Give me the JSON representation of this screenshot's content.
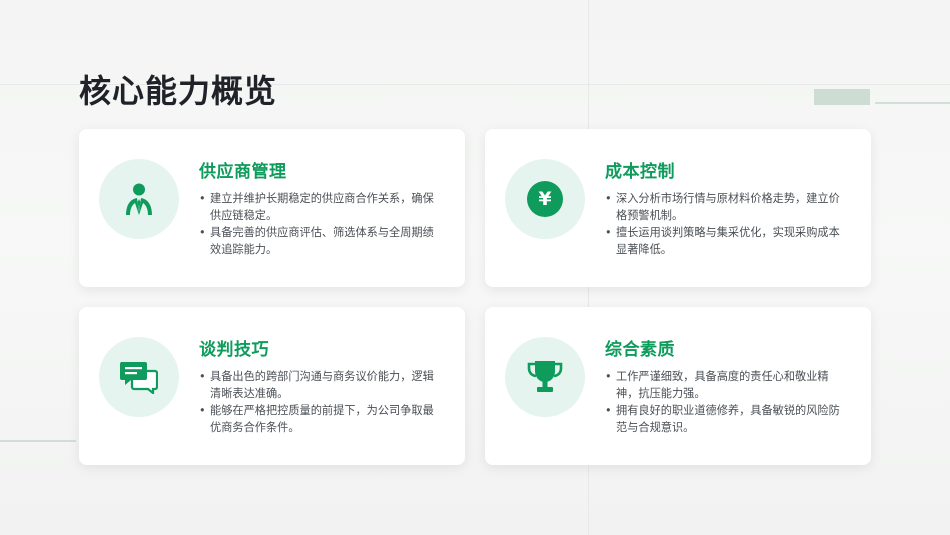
{
  "page": {
    "title": "核心能力概览",
    "accent_color": "#0e9b5c",
    "icon_bg_color": "#e5f4ee"
  },
  "cards": [
    {
      "title": "供应商管理",
      "icon": "user-tie-icon",
      "points": [
        "建立并维护长期稳定的供应商合作关系，确保供应链稳定。",
        "具备完善的供应商评估、筛选体系与全周期绩效追踪能力。"
      ]
    },
    {
      "title": "成本控制",
      "icon": "yen-coin-icon",
      "icon_glyph": "¥",
      "points": [
        "深入分析市场行情与原材料价格走势，建立价格预警机制。",
        "擅长运用谈判策略与集采优化，实现采购成本显著降低。"
      ]
    },
    {
      "title": "谈判技巧",
      "icon": "chat-bubbles-icon",
      "points": [
        "具备出色的跨部门沟通与商务议价能力，逻辑清晰表达准确。",
        "能够在严格把控质量的前提下，为公司争取最优商务合作条件。"
      ]
    },
    {
      "title": "综合素质",
      "icon": "trophy-icon",
      "points": [
        "工作严谨细致，具备高度的责任心和敬业精神，抗压能力强。",
        "拥有良好的职业道德修养，具备敏锐的风险防范与合规意识。"
      ]
    }
  ]
}
